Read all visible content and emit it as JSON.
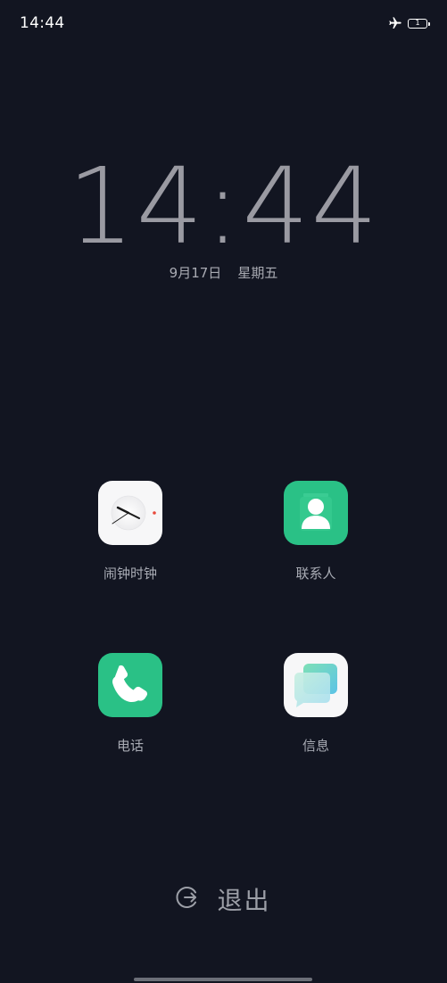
{
  "status_bar": {
    "time": "14:44",
    "battery_level": "1"
  },
  "clock": {
    "time": "14:44",
    "date": "9月17日",
    "weekday": "星期五"
  },
  "apps": [
    {
      "label": "闹钟时钟",
      "icon": "alarm-clock-icon"
    },
    {
      "label": "联系人",
      "icon": "contacts-icon"
    },
    {
      "label": "电话",
      "icon": "phone-icon"
    },
    {
      "label": "信息",
      "icon": "messages-icon"
    }
  ],
  "exit": {
    "label": "退出",
    "icon": "exit-icon"
  },
  "colors": {
    "background": "#121521",
    "app_green": "#2ac186"
  }
}
